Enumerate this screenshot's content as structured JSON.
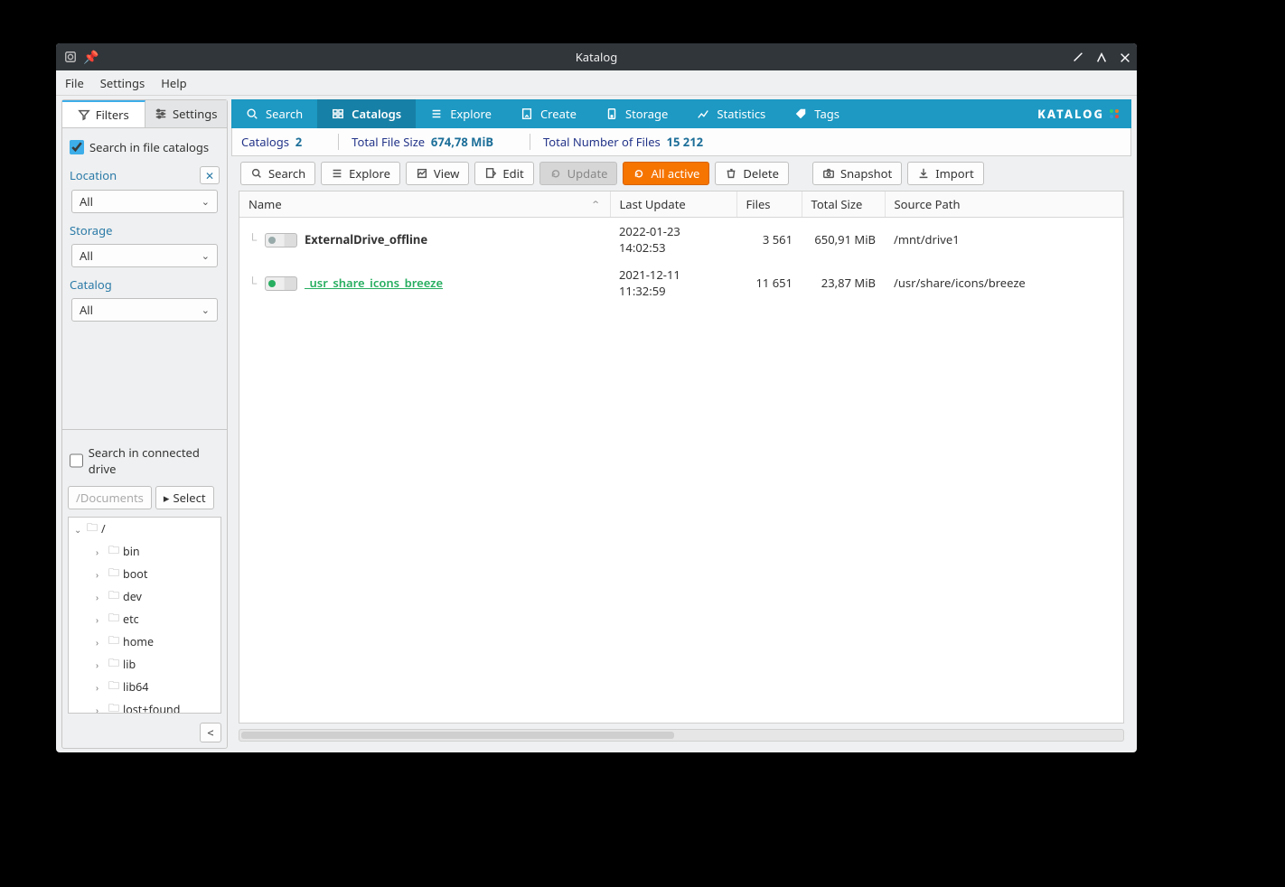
{
  "window": {
    "title": "Katalog"
  },
  "menubar": [
    "File",
    "Settings",
    "Help"
  ],
  "sidepane": {
    "tabs": [
      {
        "label": "Filters",
        "icon": "filter-icon",
        "active": true
      },
      {
        "label": "Settings",
        "icon": "sliders-icon",
        "active": false
      }
    ],
    "search_catalogs_checked": true,
    "search_catalogs_label": "Search in file catalogs",
    "groups": {
      "location": {
        "label": "Location",
        "value": "All"
      },
      "storage": {
        "label": "Storage",
        "value": "All"
      },
      "catalog": {
        "label": "Catalog",
        "value": "All"
      }
    },
    "search_drive_checked": false,
    "search_drive_label": "Search in connected drive",
    "path_input": "/Documents",
    "select_btn": "Select",
    "tree": [
      {
        "label": "/",
        "level": 0,
        "open": true
      },
      {
        "label": "bin",
        "level": 1
      },
      {
        "label": "boot",
        "level": 1
      },
      {
        "label": "dev",
        "level": 1
      },
      {
        "label": "etc",
        "level": 1
      },
      {
        "label": "home",
        "level": 1
      },
      {
        "label": "lib",
        "level": 1
      },
      {
        "label": "lib64",
        "level": 1
      },
      {
        "label": "lost+found",
        "level": 1
      }
    ]
  },
  "nav": [
    {
      "label": "Search",
      "icon": "search-icon"
    },
    {
      "label": "Catalogs",
      "icon": "catalogs-icon",
      "active": true
    },
    {
      "label": "Explore",
      "icon": "explore-icon"
    },
    {
      "label": "Create",
      "icon": "create-icon"
    },
    {
      "label": "Storage",
      "icon": "storage-icon"
    },
    {
      "label": "Statistics",
      "icon": "stats-icon"
    },
    {
      "label": "Tags",
      "icon": "tag-icon"
    }
  ],
  "brand": "KATALOG",
  "stats": {
    "catalogs_label": "Catalogs",
    "catalogs_value": "2",
    "filesize_label": "Total File Size",
    "filesize_value": "674,78 MiB",
    "filecount_label": "Total Number of Files",
    "filecount_value": "15 212"
  },
  "toolbar": {
    "search": "Search",
    "explore": "Explore",
    "view": "View",
    "edit": "Edit",
    "update": "Update",
    "allactive": "All active",
    "delete": "Delete",
    "snapshot": "Snapshot",
    "import": "Import"
  },
  "table": {
    "headers": {
      "name": "Name",
      "last": "Last Update",
      "files": "Files",
      "size": "Total Size",
      "source": "Source Path"
    },
    "rows": [
      {
        "status": "off",
        "name": "ExternalDrive_offline",
        "green": false,
        "last": "2022-01-23 14:02:53",
        "files": "3 561",
        "size": "650,91 MiB",
        "source": "/mnt/drive1"
      },
      {
        "status": "on",
        "name": "_usr_share_icons_breeze",
        "green": true,
        "last": "2021-12-11 11:32:59",
        "files": "11 651",
        "size": "23,87 MiB",
        "source": "/usr/share/icons/breeze"
      }
    ]
  }
}
